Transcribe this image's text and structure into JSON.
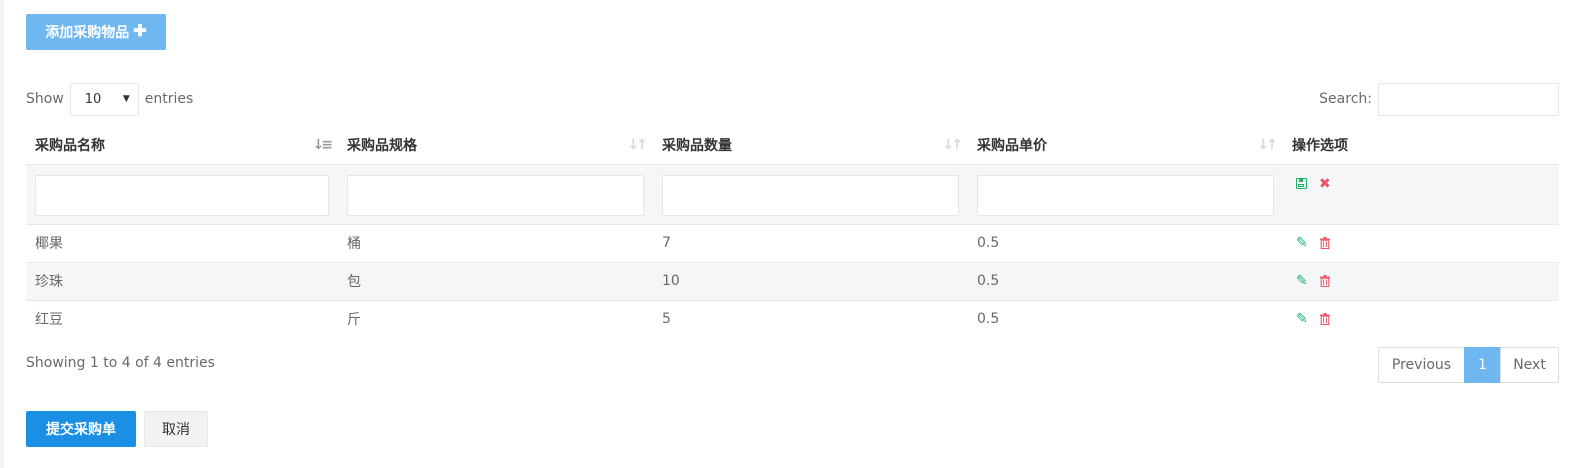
{
  "toolbar": {
    "add_label": "添加采购物品",
    "add_icon": "plus-icon"
  },
  "length_control": {
    "show_label": "Show",
    "selected": "10",
    "entries_label": "entries"
  },
  "search": {
    "label": "Search:",
    "value": ""
  },
  "table": {
    "columns": [
      {
        "label": "采购品名称",
        "sort": "sorted-asc"
      },
      {
        "label": "采购品规格",
        "sort": "sortable"
      },
      {
        "label": "采购品数量",
        "sort": "sortable"
      },
      {
        "label": "采购品单价",
        "sort": "sortable"
      },
      {
        "label": "操作选项",
        "sort": "none"
      }
    ],
    "edit_row": {
      "name": "",
      "spec": "",
      "quantity": "",
      "price": "",
      "save_icon": "save-icon",
      "cancel_icon": "close-icon"
    },
    "rows": [
      {
        "name": "椰果",
        "spec": "桶",
        "quantity": "7",
        "price": "0.5"
      },
      {
        "name": "珍珠",
        "spec": "包",
        "quantity": "10",
        "price": "0.5"
      },
      {
        "name": "红豆",
        "spec": "斤",
        "quantity": "5",
        "price": "0.5"
      }
    ]
  },
  "info": "Showing 1 to 4 of 4 entries",
  "pagination": {
    "previous": "Previous",
    "current": "1",
    "next": "Next"
  },
  "footer": {
    "submit_label": "提交采购单",
    "cancel_label": "取消"
  },
  "colors": {
    "primary": "#1a8fe3",
    "light_primary": "#6fb7f1",
    "success": "#1cb36a",
    "danger": "#ed5565"
  }
}
